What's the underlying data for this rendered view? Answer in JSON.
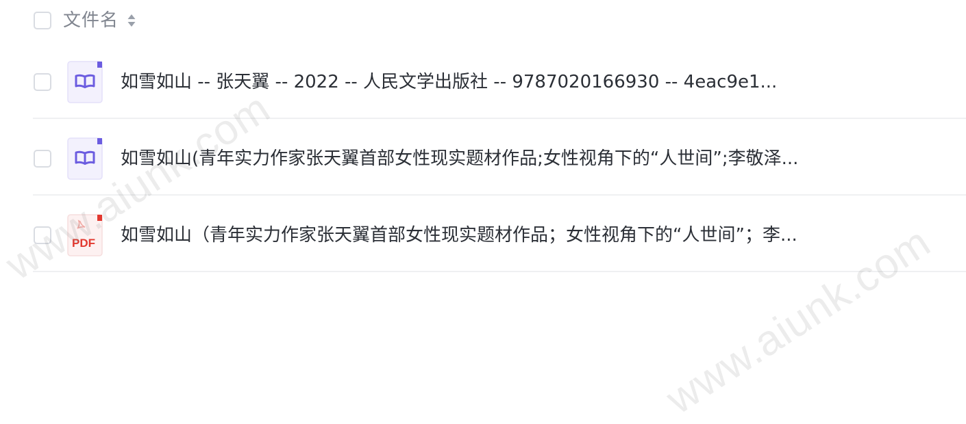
{
  "header": {
    "title": "文件名"
  },
  "files": [
    {
      "name": "如雪如山 -- 张天翼 -- 2022 -- 人民文学出版社 -- 9787020166930 -- 4eac9e1...",
      "type": "epub",
      "icon": "book-icon"
    },
    {
      "name": "如雪如山(青年实力作家张天翼首部女性现实题材作品;女性视角下的“人世间”;李敬泽...",
      "type": "epub",
      "icon": "book-icon"
    },
    {
      "name": "如雪如山（青年实力作家张天翼首部女性现实题材作品；女性视角下的“人世间”；李...",
      "type": "pdf",
      "icon": "pdf-icon",
      "badge": "PDF"
    }
  ],
  "watermark": {
    "text": "www.aiunk.com"
  },
  "colors": {
    "epub_icon_bg": "#f3f1fd",
    "epub_icon_accent": "#6b5ce0",
    "pdf_icon_bg": "#fdf1f1",
    "pdf_icon_accent": "#e2382f",
    "divider": "#eff0f2",
    "checkbox_border": "#d9dce2",
    "header_text": "#80858f",
    "body_text": "#2b2f36"
  }
}
